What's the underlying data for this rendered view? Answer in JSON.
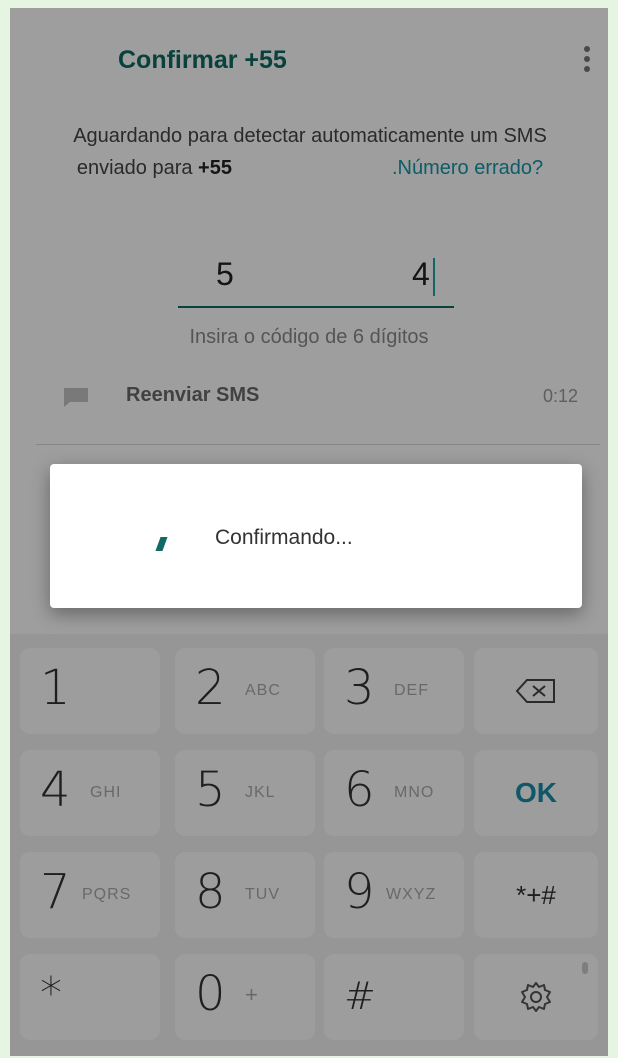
{
  "header": {
    "title": "Confirmar +55",
    "menu_icon": "more-vert-icon"
  },
  "description": {
    "line_prefix": "Aguardando para detectar automaticamente um SMS enviado para ",
    "phone": "+55",
    "wrong_number_link": ".Número errado?"
  },
  "code_input": {
    "digit_1": "5",
    "digit_6": "4",
    "hint": "Insira o código de 6 dígitos"
  },
  "resend": {
    "icon": "sms-icon",
    "label": "Reenviar SMS",
    "timer": "0:12"
  },
  "dialog": {
    "text": "Confirmando...",
    "icon": "spinner-icon"
  },
  "keypad": {
    "k1": {
      "num": "1",
      "letters": ""
    },
    "k2": {
      "num": "2",
      "letters": "ABC"
    },
    "k3": {
      "num": "3",
      "letters": "DEF"
    },
    "k4": {
      "num": "4",
      "letters": "GHI"
    },
    "k5": {
      "num": "5",
      "letters": "JKL"
    },
    "k6": {
      "num": "6",
      "letters": "MNO"
    },
    "k7": {
      "num": "7",
      "letters": "PQRS"
    },
    "k8": {
      "num": "8",
      "letters": "TUV"
    },
    "k9": {
      "num": "9",
      "letters": "WXYZ"
    },
    "k0": {
      "num": "0",
      "letters": "+"
    },
    "star": "*",
    "hash": "#",
    "ok": "OK",
    "symbols": "*+#",
    "backspace_icon": "backspace-icon",
    "settings_icon": "gear-icon"
  },
  "colors": {
    "accent": "#0f6b63",
    "link": "#1596aa",
    "frame": "#e6f5e1"
  }
}
